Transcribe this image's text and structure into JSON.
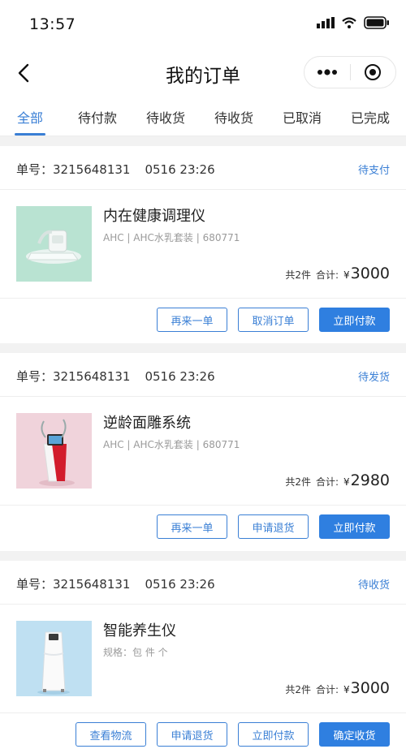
{
  "status_bar": {
    "time": "13:57",
    "icons": [
      "signal-icon",
      "wifi-icon",
      "battery-icon"
    ]
  },
  "nav": {
    "title": "我的订单",
    "back_icon": "back-arrow-icon",
    "menu_icon": "more-dots-icon",
    "close_icon": "record-circle-icon"
  },
  "tabs": [
    {
      "label": "全部",
      "active": true
    },
    {
      "label": "待付款"
    },
    {
      "label": "待收货"
    },
    {
      "label": "待收货"
    },
    {
      "label": "已取消"
    },
    {
      "label": "已完成"
    }
  ],
  "colors": {
    "accent": "#3a7fd5",
    "primary_button": "#2f7fe0",
    "divider": "#f2f2f2"
  },
  "orders": [
    {
      "order_label": "单号：",
      "order_no": "3215648131",
      "datetime": "0516 23:26",
      "status": "待支付",
      "product_name": "内在健康调理仪",
      "spec": "AHC |  AHC水乳套装  | 680771",
      "count": "共2件",
      "total_label": "合计:",
      "currency": "¥",
      "price": "3000",
      "buttons": [
        "再来一单",
        "取消订单",
        "立即付款"
      ]
    },
    {
      "order_label": "单号：",
      "order_no": "3215648131",
      "datetime": "0516 23:26",
      "status": "待发货",
      "product_name": "逆龄面雕系统",
      "spec": "AHC |  AHC水乳套装  | 680771",
      "count": "共2件",
      "total_label": "合计:",
      "currency": "¥",
      "price": "2980",
      "buttons": [
        "再来一单",
        "申请退货",
        "立即付款"
      ]
    },
    {
      "order_label": "单号：",
      "order_no": "3215648131",
      "datetime": "0516 23:26",
      "status": "待收货",
      "product_name": "智能养生仪",
      "spec": "规格：包 件 个",
      "count": "共2件",
      "total_label": "合计:",
      "currency": "¥",
      "price": "3000",
      "buttons": [
        "查看物流",
        "申请退货",
        "立即付款",
        "确定收货"
      ]
    }
  ]
}
